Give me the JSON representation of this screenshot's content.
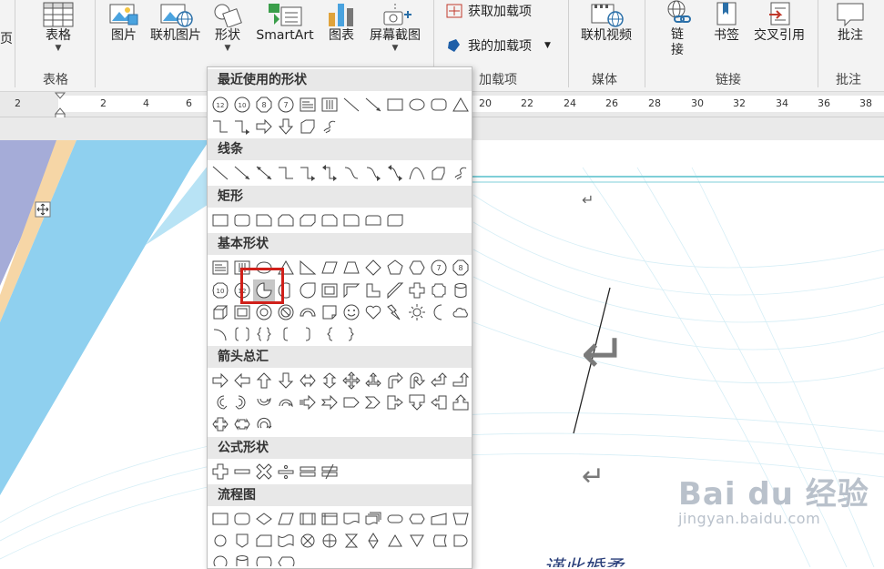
{
  "ribbon": {
    "left_cut_label": "页",
    "table": {
      "label": "表格",
      "group": "表格"
    },
    "picture": {
      "label": "图片"
    },
    "online_picture": {
      "label": "联机图片"
    },
    "shapes": {
      "label": "形状"
    },
    "smartart": {
      "label": "SmartArt"
    },
    "chart": {
      "label": "图表"
    },
    "screenshot": {
      "label": "屏幕截图"
    },
    "get_addins": {
      "label": "获取加载项"
    },
    "my_addins": {
      "label": "我的加载项"
    },
    "addins_group": "加载项",
    "online_video": {
      "label": "联机视频"
    },
    "media_group": "媒体",
    "link": {
      "label": "链\n接"
    },
    "link_l1": "链",
    "link_l2": "接",
    "bookmark": {
      "label": "书签"
    },
    "cross_ref": {
      "label": "交叉引用"
    },
    "links_group": "链接",
    "comment": {
      "label": "批注"
    },
    "comments_group": "批注"
  },
  "ruler": {
    "labels": [
      "2",
      "2",
      "4",
      "6",
      "20",
      "22",
      "24",
      "26",
      "28",
      "30",
      "32",
      "34",
      "36",
      "38"
    ]
  },
  "shapes_panel": {
    "categories": {
      "recent": "最近使用的形状",
      "lines": "线条",
      "rectangles": "矩形",
      "basic": "基本形状",
      "arrows": "箭头总汇",
      "equation": "公式形状",
      "flowchart": "流程图"
    },
    "badge_12": "12",
    "badge_10": "10",
    "badge_8": "8",
    "badge_7": "7"
  },
  "document": {
    "para_mark": "↵",
    "bottom_text": "谨此婚柔"
  },
  "watermark": {
    "brand": "Bai du 经验",
    "url": "jingyan.baidu.com"
  },
  "colors": {
    "ribbon_bg": "#f3f3f3",
    "highlight_red": "#d0201a",
    "teal_line": "#7fcfd8",
    "sky_blue": "#8fd0ef"
  }
}
